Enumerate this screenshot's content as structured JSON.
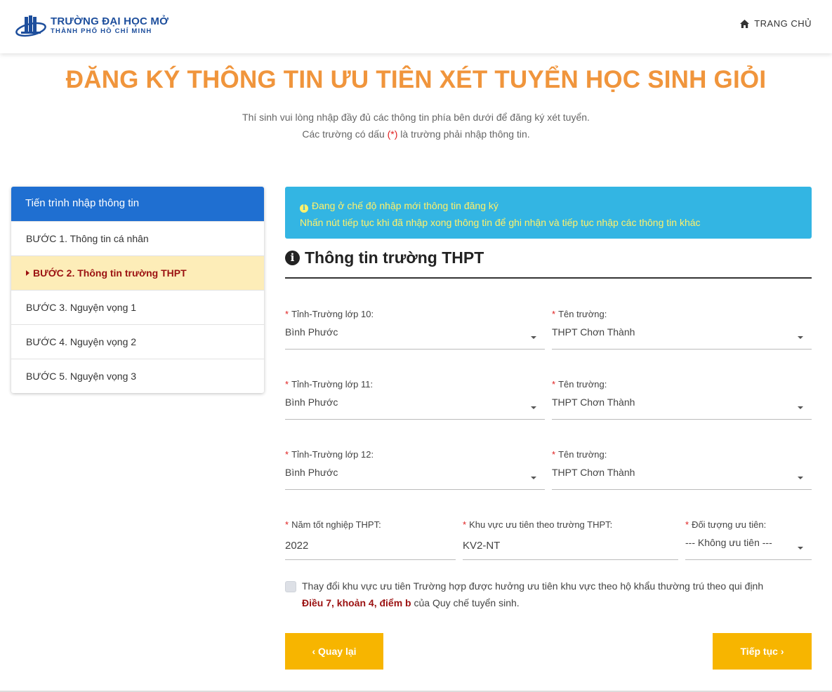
{
  "header": {
    "logo_line1": "TRƯỜNG ĐẠI HỌC MỞ",
    "logo_line2": "THÀNH PHỐ HỒ CHÍ MINH",
    "home_icon": "home-icon",
    "home_label": "TRANG CHỦ"
  },
  "page": {
    "title": "ĐĂNG KÝ THÔNG TIN ƯU TIÊN XÉT TUYỂN HỌC SINH GIỎI",
    "intro_line1": "Thí sinh vui lòng nhập đầy đủ các thông tin phía bên dưới để đăng ký xét tuyển.",
    "intro_line2_before": "Các trường có dấu ",
    "intro_line2_marker": "(*)",
    "intro_line2_after": " là trường phải nhập thông tin."
  },
  "sidebar": {
    "title": "Tiến trình nhập thông tin",
    "steps": [
      {
        "label": "BƯỚC 1. Thông tin cá nhân",
        "active": false
      },
      {
        "label": "BƯỚC 2. Thông tin trường THPT",
        "active": true
      },
      {
        "label": "BƯỚC 3. Nguyện vọng 1",
        "active": false
      },
      {
        "label": "BƯỚC 4. Nguyện vọng 2",
        "active": false
      },
      {
        "label": "BƯỚC 5. Nguyện vọng 3",
        "active": false
      }
    ]
  },
  "info": {
    "line1": "Đang ở chế độ nhập mới thông tin đăng ký",
    "line2": "Nhấn nút tiếp tục khi đã nhập xong thông tin để ghi nhận và tiếp tục nhập các thông tin khác",
    "bg_color": "#33b5e3",
    "text_color": "#fff16a"
  },
  "section": {
    "icon": "info-circle-icon",
    "title": "Thông tin trường THPT"
  },
  "form": {
    "required_marker": "*",
    "province10_label": "Tỉnh-Trường lớp 10:",
    "province10_value": "Bình Phước",
    "school10_label": "Tên trường:",
    "school10_value": "THPT Chơn Thành",
    "province11_label": "Tỉnh-Trường lớp 11:",
    "province11_value": "Bình Phước",
    "school11_label": "Tên trường:",
    "school11_value": "THPT Chơn Thành",
    "province12_label": "Tỉnh-Trường lớp 12:",
    "province12_value": "Bình Phước",
    "school12_label": "Tên trường:",
    "school12_value": "THPT Chơn Thành",
    "grad_year_label": "Năm tốt nghiệp THPT:",
    "grad_year_value": "2022",
    "area_label": "Khu vực ưu tiên theo trường THPT:",
    "area_value": "KV2-NT",
    "priority_label": "Đối tượng ưu tiên:",
    "priority_value": "--- Không ưu tiên ---",
    "change_area_text": "Thay đổi khu vực ưu tiên Trường hợp được hưởng ưu tiên khu vực theo hộ khẩu thường trú theo qui định",
    "change_area_ref": "Điều 7, khoản 4, điểm b",
    "change_area_suffix": " của Quy chế tuyển sinh.",
    "change_area_checked": false
  },
  "buttons": {
    "back_label": "Quay lại",
    "next_label": "Tiếp tục",
    "color": "#f7b500"
  }
}
